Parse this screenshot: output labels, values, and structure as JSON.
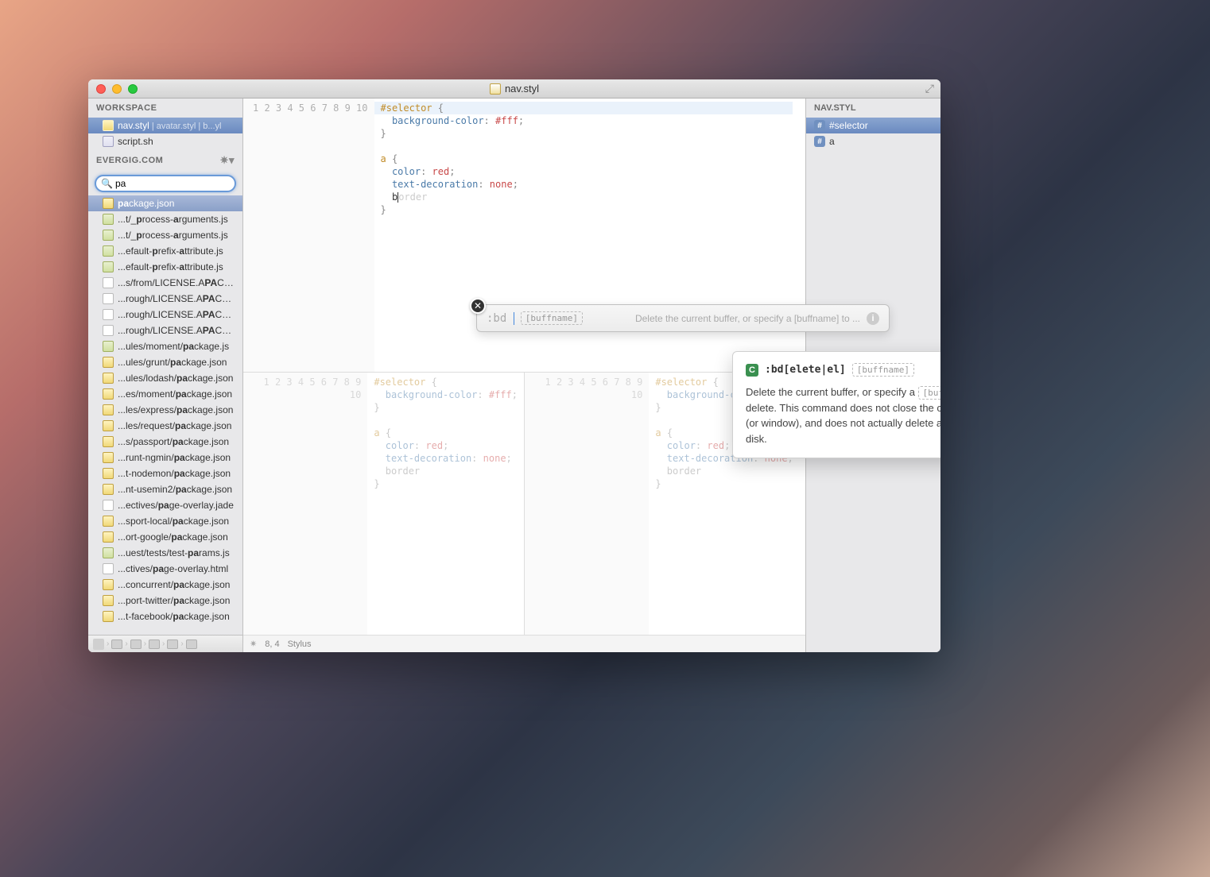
{
  "window": {
    "title": "nav.styl"
  },
  "sidebar": {
    "workspace_label": "WORKSPACE",
    "project_label": "EVERGIG.COM",
    "workspace_items": [
      {
        "icon": "folder",
        "label": "nav.styl",
        "sub": " | avatar.styl | b...yl"
      },
      {
        "icon": "script",
        "label": "script.sh",
        "sub": ""
      }
    ],
    "search_value": "pa",
    "results": [
      {
        "icon": "folder",
        "html": "<b>pa</b>ckage.json",
        "sel": true
      },
      {
        "icon": "jsfile",
        "html": "...t/_<b>p</b>rocess-<b>a</b>rguments.js"
      },
      {
        "icon": "jsfile",
        "html": "...t/_<b>p</b>rocess-<b>a</b>rguments.js"
      },
      {
        "icon": "jsfile",
        "html": "...efault-<b>p</b>refix-<b>a</b>ttribute.js"
      },
      {
        "icon": "jsfile",
        "html": "...efault-<b>p</b>refix-<b>a</b>ttribute.js"
      },
      {
        "icon": "text",
        "html": "...s/from/LICENSE.A<b>PA</b>CHE2"
      },
      {
        "icon": "text",
        "html": "...rough/LICENSE.A<b>PA</b>CHE2"
      },
      {
        "icon": "text",
        "html": "...rough/LICENSE.A<b>PA</b>CHE2"
      },
      {
        "icon": "text",
        "html": "...rough/LICENSE.A<b>PA</b>CHE2"
      },
      {
        "icon": "jsfile",
        "html": "...ules/moment/<b>pa</b>ckage.js"
      },
      {
        "icon": "folder",
        "html": "...ules/grunt/<b>pa</b>ckage.json"
      },
      {
        "icon": "folder",
        "html": "...ules/lodash/<b>pa</b>ckage.json"
      },
      {
        "icon": "folder",
        "html": "...es/moment/<b>pa</b>ckage.json"
      },
      {
        "icon": "folder",
        "html": "...les/express/<b>pa</b>ckage.json"
      },
      {
        "icon": "folder",
        "html": "...les/request/<b>pa</b>ckage.json"
      },
      {
        "icon": "folder",
        "html": "...s/passport/<b>pa</b>ckage.json"
      },
      {
        "icon": "folder",
        "html": "...runt-ngmin/<b>pa</b>ckage.json"
      },
      {
        "icon": "folder",
        "html": "...t-nodemon/<b>pa</b>ckage.json"
      },
      {
        "icon": "folder",
        "html": "...nt-usemin2/<b>pa</b>ckage.json"
      },
      {
        "icon": "text",
        "html": "...ectives/<b>pa</b>ge-overlay.jade"
      },
      {
        "icon": "folder",
        "html": "...sport-local/<b>pa</b>ckage.json"
      },
      {
        "icon": "folder",
        "html": "...ort-google/<b>pa</b>ckage.json"
      },
      {
        "icon": "jsfile",
        "html": "...uest/tests/test-<b>pa</b>rams.js"
      },
      {
        "icon": "text",
        "html": "...ctives/<b>pa</b>ge-overlay.html"
      },
      {
        "icon": "folder",
        "html": "...concurrent/<b>pa</b>ckage.json"
      },
      {
        "icon": "folder",
        "html": "...port-twitter/<b>pa</b>ckage.json"
      },
      {
        "icon": "folder",
        "html": "...t-facebook/<b>pa</b>ckage.json"
      }
    ]
  },
  "editor": {
    "lines": [
      "#selector {",
      "  background-color: #fff;",
      "}",
      "",
      "a {",
      "  color: red;",
      "  text-decoration: none;",
      "  border",
      "}",
      ""
    ],
    "cursor_pos": "8, 4",
    "language": "Stylus"
  },
  "outline": {
    "header": "NAV.STYL",
    "items": [
      {
        "label": "#selector",
        "selected": true
      },
      {
        "label": "a",
        "selected": false
      }
    ]
  },
  "command": {
    "prefix": ":bd",
    "arg_hint": "[buffname]",
    "summary": "Delete the current buffer, or specify a [buffname] to ..."
  },
  "tooltip": {
    "cmd": ":bd[elete|el]",
    "arg": "[buffname]",
    "body_pre": "Delete the current buffer, or specify a ",
    "body_arg": "[buffname]",
    "body_post": " to delete. This command does not close the current view (or window), and does not actually delete any files from disk."
  }
}
